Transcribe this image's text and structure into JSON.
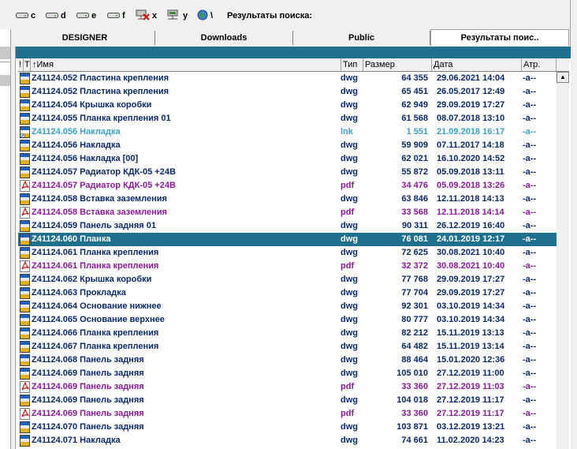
{
  "drives": [
    {
      "letter": "c",
      "icon": "drive-icon"
    },
    {
      "letter": "d",
      "icon": "drive-icon"
    },
    {
      "letter": "e",
      "icon": "drive-icon"
    },
    {
      "letter": "f",
      "icon": "drive-icon"
    },
    {
      "letter": "x",
      "icon": "disconnected-network-drive-icon"
    },
    {
      "letter": "y",
      "icon": "network-drive-icon"
    },
    {
      "letter": "\\",
      "icon": "globe-icon"
    }
  ],
  "path_label": "Результаты поиска:",
  "tabs": [
    {
      "label": "DESIGNER"
    },
    {
      "label": "Downloads"
    },
    {
      "label": "Public"
    },
    {
      "label": "Результаты поис.."
    }
  ],
  "columns": {
    "a": "!",
    "t": "T",
    "name": "↑Имя",
    "ext": "Тип",
    "size": "Размер",
    "date": "Дата",
    "attr": "Атр."
  },
  "colors": {
    "accent": "#1f6f8f",
    "dwg": "#0a2a6a",
    "lnk": "#3aa0c8",
    "pdf": "#8a1a9a"
  },
  "files": [
    {
      "name": "Z41124.052 Пластина крепления",
      "ext": "dwg",
      "size": "64 355",
      "date": "29.06.2021 14:04",
      "attr": "-a--",
      "type": "dwg"
    },
    {
      "name": "Z41124.052 Пластина крепления",
      "ext": "dwg",
      "size": "65 451",
      "date": "26.05.2017 12:49",
      "attr": "-a--",
      "type": "dwg"
    },
    {
      "name": "Z41124.054 Крышка коробки",
      "ext": "dwg",
      "size": "62 949",
      "date": "29.09.2019 17:27",
      "attr": "-a--",
      "type": "dwg"
    },
    {
      "name": "Z41124.055 Планка крепления 01",
      "ext": "dwg",
      "size": "61 568",
      "date": "08.07.2018 13:10",
      "attr": "-a--",
      "type": "dwg"
    },
    {
      "name": "Z41124.056 Накладка",
      "ext": "lnk",
      "size": "1 551",
      "date": "21.09.2018 16:17",
      "attr": "-a--",
      "type": "lnk"
    },
    {
      "name": "Z41124.056 Накладка",
      "ext": "dwg",
      "size": "59 909",
      "date": "07.11.2017 14:18",
      "attr": "-a--",
      "type": "dwg"
    },
    {
      "name": "Z41124.056 Накладка [00]",
      "ext": "dwg",
      "size": "62 021",
      "date": "16.10.2020 14:52",
      "attr": "-a--",
      "type": "dwg"
    },
    {
      "name": "Z41124.057 Радиатор КДК-05 +24В",
      "ext": "dwg",
      "size": "55 872",
      "date": "05.09.2018 13:11",
      "attr": "-a--",
      "type": "dwg"
    },
    {
      "name": "Z41124.057 Радиатор КДК-05 +24В",
      "ext": "pdf",
      "size": "34 476",
      "date": "05.09.2018 13:26",
      "attr": "-a--",
      "type": "pdf"
    },
    {
      "name": "Z41124.058 Вставка заземления",
      "ext": "dwg",
      "size": "63 846",
      "date": "12.11.2018 14:13",
      "attr": "-a--",
      "type": "dwg"
    },
    {
      "name": "Z41124.058 Вставка заземления",
      "ext": "pdf",
      "size": "33 568",
      "date": "12.11.2018 14:14",
      "attr": "-a--",
      "type": "pdf"
    },
    {
      "name": "Z41124.059 Панель задняя 01",
      "ext": "dwg",
      "size": "90 311",
      "date": "26.12.2019 16:40",
      "attr": "-a--",
      "type": "dwg"
    },
    {
      "name": "Z41124.060 Планка",
      "ext": "dwg",
      "size": "76 081",
      "date": "24.01.2019 12:17",
      "attr": "-a--",
      "type": "dwg",
      "selected": true
    },
    {
      "name": "Z41124.061 Планка крепления",
      "ext": "dwg",
      "size": "72 625",
      "date": "30.08.2021 10:40",
      "attr": "-a--",
      "type": "dwg"
    },
    {
      "name": "Z41124.061 Планка крепления",
      "ext": "pdf",
      "size": "32 372",
      "date": "30.08.2021 10:40",
      "attr": "-a--",
      "type": "pdf"
    },
    {
      "name": "Z41124.062 Крышка коробки",
      "ext": "dwg",
      "size": "77 768",
      "date": "29.09.2019 17:27",
      "attr": "-a--",
      "type": "dwg"
    },
    {
      "name": "Z41124.063 Прокладка",
      "ext": "dwg",
      "size": "77 704",
      "date": "29.09.2019 17:27",
      "attr": "-a--",
      "type": "dwg"
    },
    {
      "name": "Z41124.064 Основание нижнее",
      "ext": "dwg",
      "size": "92 301",
      "date": "03.10.2019 14:34",
      "attr": "-a--",
      "type": "dwg"
    },
    {
      "name": "Z41124.065 Основание верхнее",
      "ext": "dwg",
      "size": "80 777",
      "date": "03.10.2019 14:34",
      "attr": "-a--",
      "type": "dwg"
    },
    {
      "name": "Z41124.066 Планка крепления",
      "ext": "dwg",
      "size": "82 212",
      "date": "15.11.2019 13:13",
      "attr": "-a--",
      "type": "dwg"
    },
    {
      "name": "Z41124.067 Планка крепления",
      "ext": "dwg",
      "size": "64 482",
      "date": "15.11.2019 13:14",
      "attr": "-a--",
      "type": "dwg"
    },
    {
      "name": "Z41124.068 Панель задняя",
      "ext": "dwg",
      "size": "88 464",
      "date": "15.01.2020 12:36",
      "attr": "-a--",
      "type": "dwg"
    },
    {
      "name": "Z41124.069 Панель задняя",
      "ext": "dwg",
      "size": "105 010",
      "date": "27.12.2019 11:00",
      "attr": "-a--",
      "type": "dwg"
    },
    {
      "name": "Z41124.069 Панель задняя",
      "ext": "pdf",
      "size": "33 360",
      "date": "27.12.2019 11:03",
      "attr": "-a--",
      "type": "pdf"
    },
    {
      "name": "Z41124.069 Панель задняя",
      "ext": "dwg",
      "size": "104 018",
      "date": "27.12.2019 11:17",
      "attr": "-a--",
      "type": "dwg"
    },
    {
      "name": "Z41124.069 Панель задняя",
      "ext": "pdf",
      "size": "33 360",
      "date": "27.12.2019 11:17",
      "attr": "-a--",
      "type": "pdf"
    },
    {
      "name": "Z41124.070 Панель задняя",
      "ext": "dwg",
      "size": "103 871",
      "date": "03.12.2019 13:21",
      "attr": "-a--",
      "type": "dwg"
    },
    {
      "name": "Z41124.071 Накладка",
      "ext": "dwg",
      "size": "74 661",
      "date": "11.02.2020 14:23",
      "attr": "-a--",
      "type": "dwg"
    }
  ]
}
